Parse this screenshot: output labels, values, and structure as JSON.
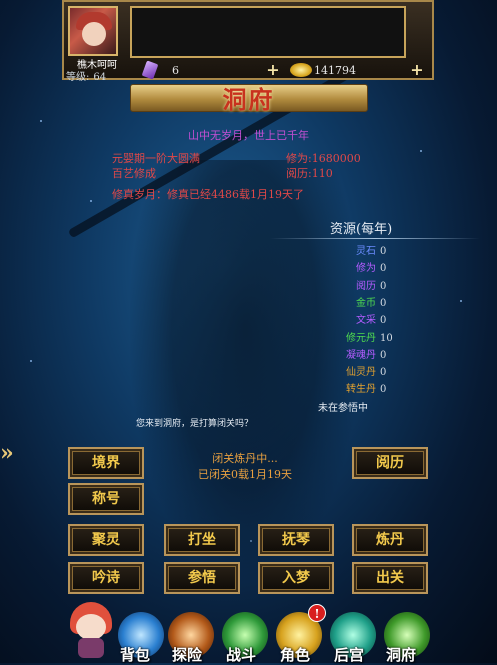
{
  "player": {
    "name": "樵木呵呵",
    "level_label": "等级",
    "level_value": "64",
    "gems": "6",
    "gold": "141794"
  },
  "title": "洞府",
  "tagline": "山中无岁月，世上已千年",
  "info": {
    "realm": "元婴期一阶大圆满",
    "cultivation_label": "修为:",
    "cultivation_value": "1680000",
    "skills": "百艺修成",
    "experience_label": "阅历:",
    "experience_value": "110",
    "years_text": "修真岁月：修真已经4486载1月19天了"
  },
  "resources": {
    "title": "资源(每年)",
    "items": [
      {
        "label": "灵石",
        "value": "0",
        "color": "#6b8cff"
      },
      {
        "label": "修为",
        "value": "0",
        "color": "#b45cff"
      },
      {
        "label": "阅历",
        "value": "0",
        "color": "#b45cff"
      },
      {
        "label": "金币",
        "value": "0",
        "color": "#4fdc4f"
      },
      {
        "label": "文采",
        "value": "0",
        "color": "#b45cff"
      },
      {
        "label": "修元丹",
        "value": "10",
        "color": "#4fdc4f"
      },
      {
        "label": "凝魂丹",
        "value": "0",
        "color": "#b45cff"
      },
      {
        "label": "仙灵丹",
        "value": "0",
        "color": "#e0a030"
      },
      {
        "label": "转生丹",
        "value": "0",
        "color": "#e0a030"
      }
    ],
    "status": "未在参悟中"
  },
  "prompt": "您来到洞府，是打算闭关吗？",
  "cultivating": {
    "status": "闭关炼丹中...",
    "time": "已闭关0载1月19天"
  },
  "buttons": {
    "realm": "境界",
    "experience": "阅历",
    "title": "称号",
    "gather": "聚灵",
    "meditate": "打坐",
    "guqin": "抚琴",
    "alchemy": "炼丹",
    "poetry": "吟诗",
    "comprehend": "参悟",
    "dream": "入梦",
    "exit": "出关"
  },
  "nav": {
    "bag": "背包",
    "explore": "探险",
    "battle": "战斗",
    "character": "角色",
    "palace": "后宫",
    "cave": "洞府",
    "alert": "!"
  }
}
